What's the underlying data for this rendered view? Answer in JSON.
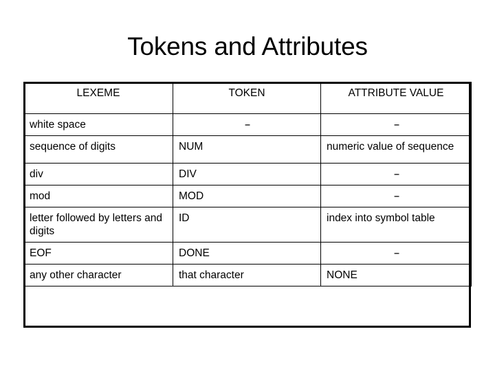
{
  "slide": {
    "title": "Tokens and Attributes"
  },
  "table": {
    "headers": {
      "lexeme": "LEXEME",
      "token": "TOKEN",
      "attribute": "ATTRIBUTE VALUE"
    },
    "rows": [
      {
        "lexeme": "white space",
        "token": "--",
        "token_align": "center",
        "attribute": "--",
        "attribute_align": "center"
      },
      {
        "lexeme": "sequence of digits",
        "token": "NUM",
        "token_align": "left",
        "attribute": "numeric value of sequence",
        "attribute_align": "left"
      },
      {
        "lexeme": "div",
        "token": "DIV",
        "token_align": "left",
        "attribute": "--",
        "attribute_align": "center"
      },
      {
        "lexeme": "mod",
        "token": "MOD",
        "token_align": "left",
        "attribute": "--",
        "attribute_align": "center"
      },
      {
        "lexeme": "letter followed by letters and digits",
        "token": "ID",
        "token_align": "left",
        "attribute": "index into symbol table",
        "attribute_align": "left"
      },
      {
        "lexeme": "EOF",
        "token": "DONE",
        "token_align": "left",
        "attribute": "--",
        "attribute_align": "center"
      },
      {
        "lexeme": "any other character",
        "token": "that character",
        "token_align": "left",
        "attribute": "NONE",
        "attribute_align": "left"
      }
    ]
  },
  "colors": {
    "background": "#ffffff",
    "text": "#000000",
    "border": "#000000"
  }
}
